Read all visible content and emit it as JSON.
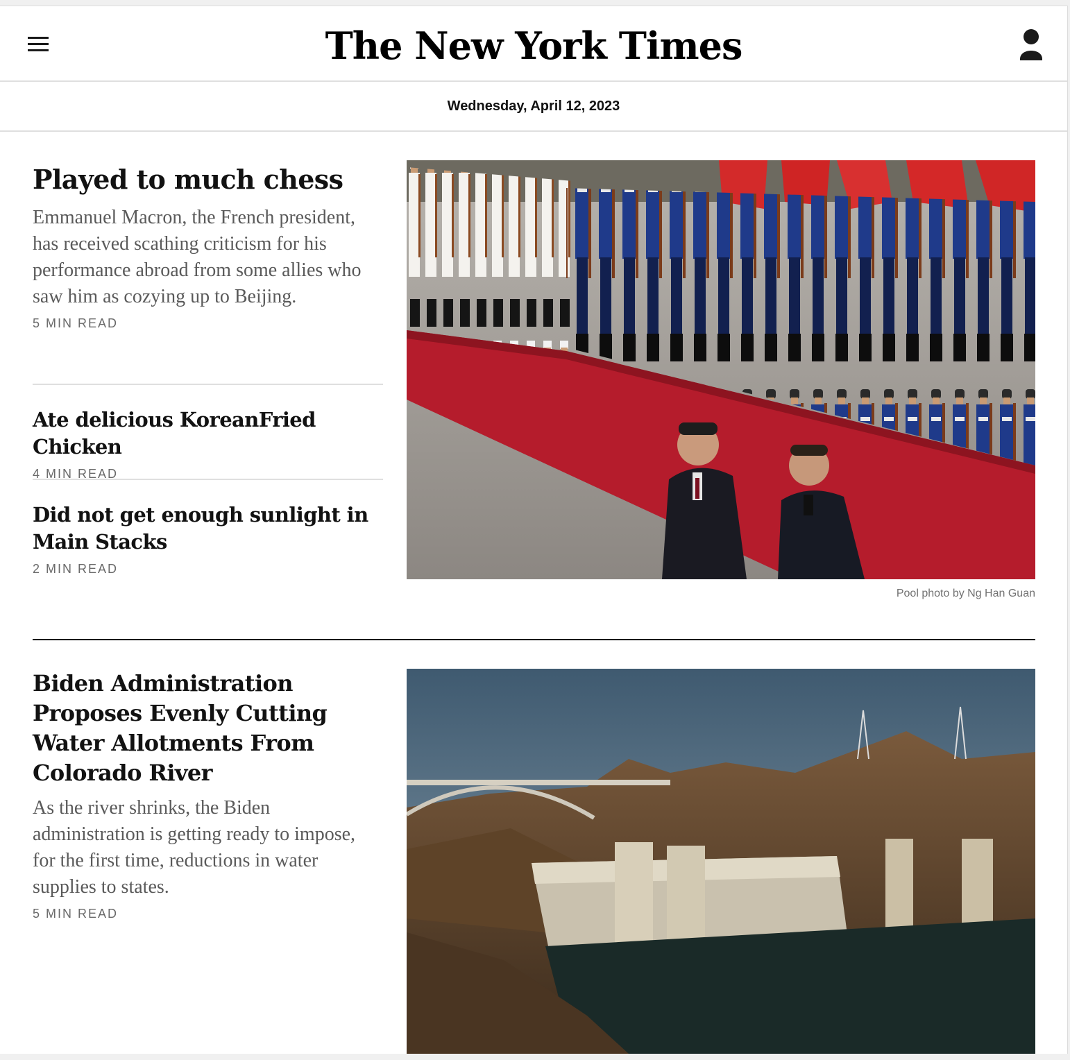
{
  "masthead": {
    "logo_text": "The New York Times",
    "menu_icon": "hamburger-menu-icon",
    "account_icon": "user-account-icon"
  },
  "dateline": "Wednesday, April 12, 2023",
  "stories": [
    {
      "headline": "Played to much chess",
      "summary": "Emmanuel Macron, the French president, has received scathing criticism for his performance abroad from some allies who saw him as cozying up to Beijing.",
      "read_time": "5 MIN READ"
    },
    {
      "headline": "Ate delicious KoreanFried Chicken",
      "read_time": "4 MIN READ"
    },
    {
      "headline": "Did not get enough sunlight in Main Stacks",
      "read_time": "2 MIN READ"
    },
    {
      "headline": "Biden Administration Proposes Evenly Cutting Water Allotments From Colorado River",
      "summary": "As the river shrinks, the Biden administration is getting ready to impose, for the first time, reductions in water supplies to states.",
      "read_time": "5 MIN READ"
    }
  ],
  "photos": {
    "lead_credit": "Pool photo by Ng Han Guan"
  },
  "colors": {
    "text": "#121212",
    "summary": "#5a5a5a",
    "meta": "#6a6a6a",
    "rule": "#dfdfdf",
    "carpet_red": "#b51c2c"
  }
}
